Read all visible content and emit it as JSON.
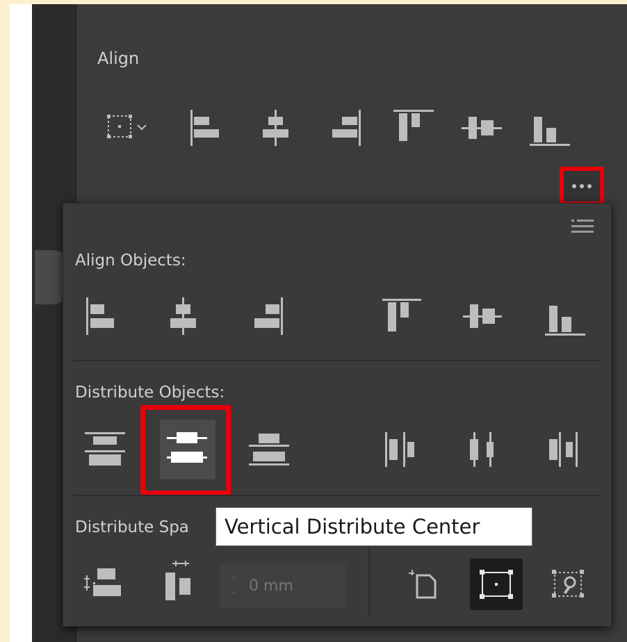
{
  "panel": {
    "title": "Align"
  },
  "flyout": {
    "align_objects_label": "Align Objects:",
    "distribute_objects_label": "Distribute Objects:",
    "distribute_spacing_label": "Distribute Spa",
    "tooltip": "Vertical Distribute Center",
    "spacing_value": "",
    "spacing_placeholder": "0 mm"
  },
  "colors": {
    "highlight": "#e8000b",
    "panel_bg": "#3b3b3b",
    "icon": "#bdbdbd"
  },
  "icons": {
    "top_row": [
      "align-to-selection-icon",
      "horizontal-align-left-icon",
      "horizontal-align-center-icon",
      "horizontal-align-right-icon",
      "vertical-align-top-icon",
      "vertical-align-center-icon",
      "vertical-align-bottom-icon"
    ],
    "more_options": "more-options-icon",
    "align_objects": [
      "horizontal-align-left-icon",
      "horizontal-align-center-icon",
      "horizontal-align-right-icon",
      "vertical-align-top-icon",
      "vertical-align-center-icon",
      "vertical-align-bottom-icon"
    ],
    "distribute_objects": [
      "vertical-distribute-top-icon",
      "vertical-distribute-center-icon",
      "vertical-distribute-bottom-icon",
      "horizontal-distribute-left-icon",
      "horizontal-distribute-center-icon",
      "horizontal-distribute-right-icon"
    ],
    "distribute_spacing": [
      "vertical-distribute-space-icon",
      "horizontal-distribute-space-icon",
      "align-to-artboard-icon",
      "align-to-selection-icon",
      "align-to-key-object-icon"
    ]
  }
}
